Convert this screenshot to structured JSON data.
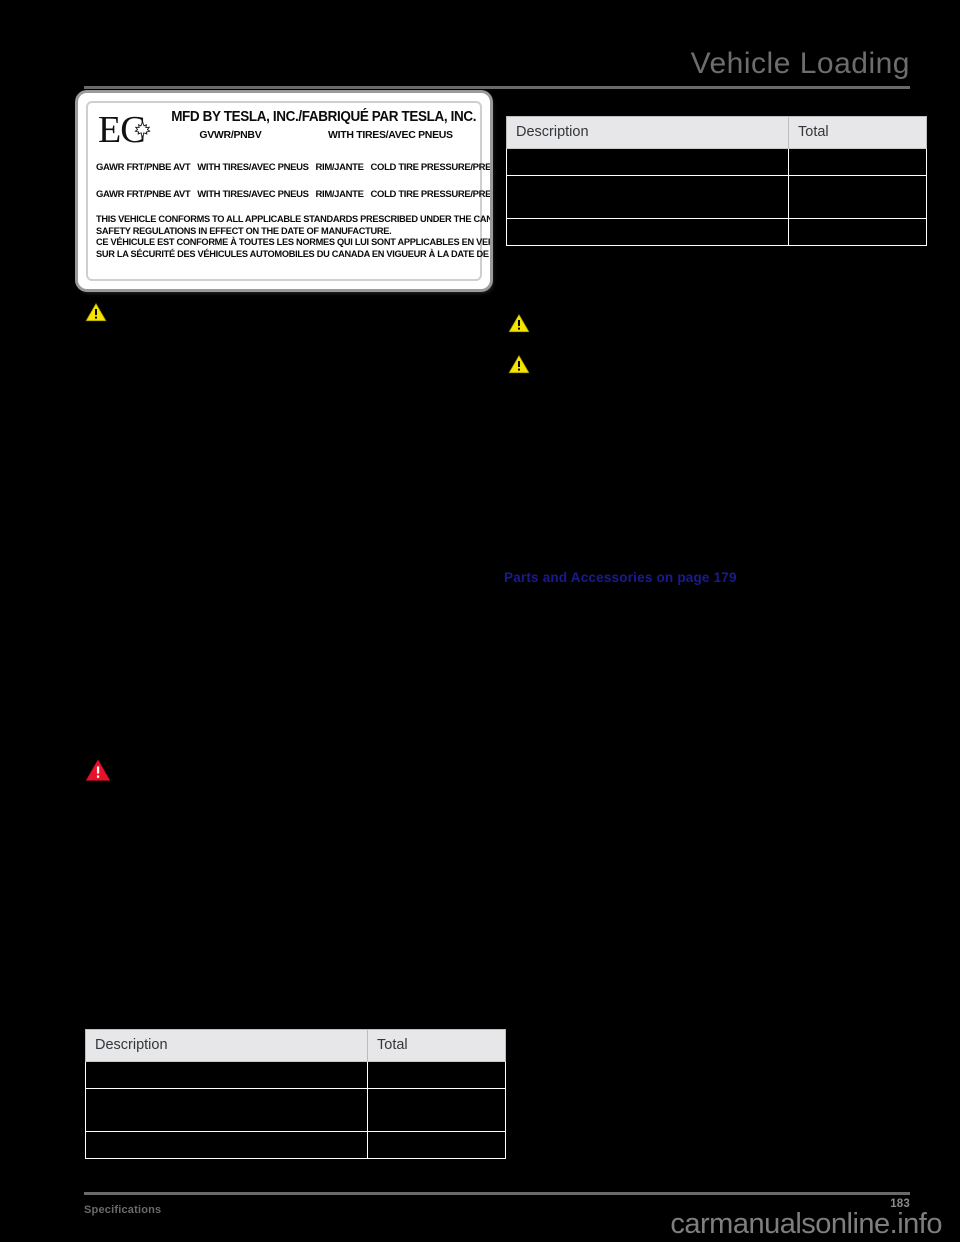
{
  "header": {
    "title": "Vehicle Loading"
  },
  "cert_label": {
    "logo_text": "EC",
    "logo_icon": "maple-leaf-icon",
    "mfd_line": "MFD BY TESLA, INC./FABRIQUÉ PAR TESLA, INC.",
    "gvwr_label": "GVWR/PNBV",
    "gvwr_tires_label": "WITH TIRES/AVEC PNEUS",
    "axle_rows": [
      {
        "gawr": "GAWR FRT/PNBE AVT",
        "tires": "WITH TIRES/AVEC PNEUS",
        "rim": "RIM/JANTE",
        "pressure": "COLD TIRE PRESSURE/PRESSION DES PNEUS À FROID"
      },
      {
        "gawr": "GAWR FRT/PNBE AVT",
        "tires": "WITH TIRES/AVEC PNEUS",
        "rim": "RIM/JANTE",
        "pressure": "COLD TIRE PRESSURE/PRESSION DES PNEUS À FROID"
      }
    ],
    "conformance_lines": [
      "THIS VEHICLE CONFORMS TO ALL APPLICABLE STANDARDS PRESCRIBED UNDER THE CANADIAN MOTOR VEHICLE",
      "SAFETY REGULATIONS IN EFFECT ON THE DATE OF MANUFACTURE.",
      "CE VÉHICULE EST CONFORME À TOUTES LES NORMES QUI LUI SONT APPLICABLES EN VERTU DU RÈGLEMENT",
      "SUR LA SÉCURITÉ DES VÉHICULES AUTOMOBILES DU CANADA EN VIGUEUR À LA DATE DE SA FABRICATION."
    ]
  },
  "tables": {
    "headers": {
      "description": "Description",
      "total": "Total"
    },
    "left_table": {
      "rows": [
        {
          "description": "",
          "total": ""
        },
        {
          "description": "",
          "total": ""
        },
        {
          "description": "",
          "total": ""
        }
      ]
    },
    "right_table": {
      "rows": [
        {
          "description": "",
          "total": ""
        },
        {
          "description": "",
          "total": ""
        },
        {
          "description": "",
          "total": ""
        }
      ]
    }
  },
  "links": {
    "parts_and_accessories": "Parts and Accessories on page 179"
  },
  "warnings": {
    "caution_icon": "warning-triangle-icon",
    "danger_icon": "danger-triangle-icon",
    "caution_color": "#f5e400",
    "danger_color": "#e8132b"
  },
  "footer": {
    "section": "Specifications",
    "page_number": "183",
    "watermark": "carmanualsonline.info"
  }
}
